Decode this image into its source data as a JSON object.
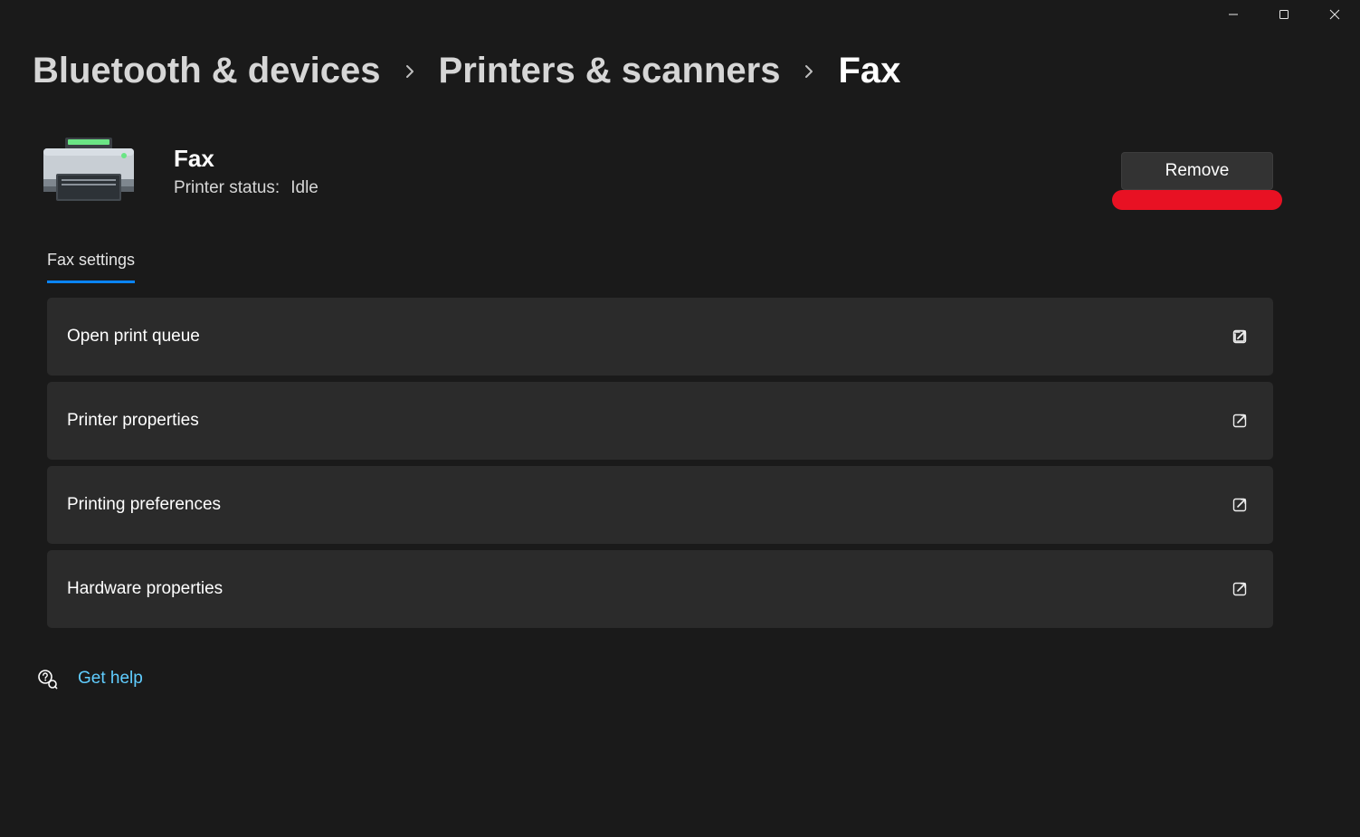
{
  "titlebar": {
    "minimize": "Minimize",
    "maximize": "Maximize",
    "close": "Close"
  },
  "breadcrumbs": {
    "l1": "Bluetooth & devices",
    "l2": "Printers & scanners",
    "current": "Fax"
  },
  "device": {
    "name": "Fax",
    "status_label": "Printer status:",
    "status_value": "Idle",
    "remove_label": "Remove"
  },
  "section": {
    "title": "Fax settings"
  },
  "settings": [
    {
      "label": "Open print queue"
    },
    {
      "label": "Printer properties"
    },
    {
      "label": "Printing preferences"
    },
    {
      "label": "Hardware properties"
    }
  ],
  "help": {
    "label": "Get help"
  }
}
